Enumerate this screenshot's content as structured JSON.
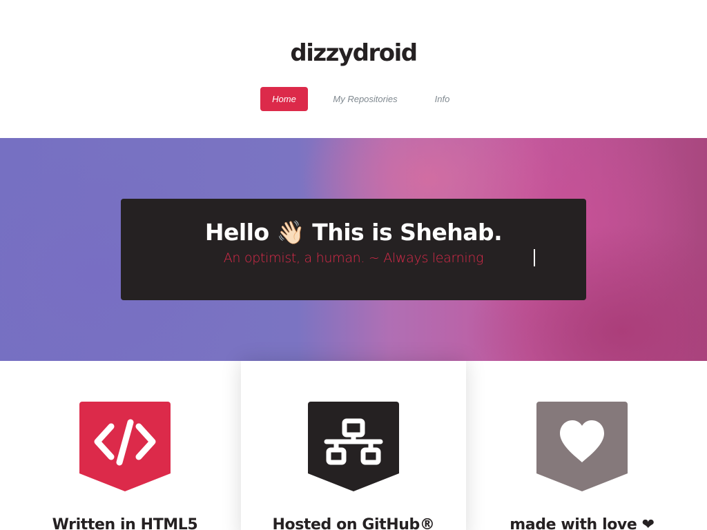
{
  "site": {
    "logo": "dizzydroid"
  },
  "nav": {
    "items": [
      {
        "label": "Home",
        "active": true
      },
      {
        "label": "My Repositories",
        "active": false
      },
      {
        "label": "Info",
        "active": false
      }
    ]
  },
  "hero": {
    "title": "Hello 👋🏻 This is Shehab.",
    "subtitle": "An optimist, a human. ~ Always learning"
  },
  "features": [
    {
      "title": "Written in HTML5",
      "icon": "code-icon",
      "color": "#dc2a4a"
    },
    {
      "title": "Hosted on GitHub®",
      "icon": "network-icon",
      "color": "#252122"
    },
    {
      "title": "made with love ❤",
      "icon": "heart-icon",
      "color": "#85797b"
    }
  ],
  "colors": {
    "accent": "#dc2a4a",
    "dark": "#252122",
    "muted": "#85797b"
  }
}
